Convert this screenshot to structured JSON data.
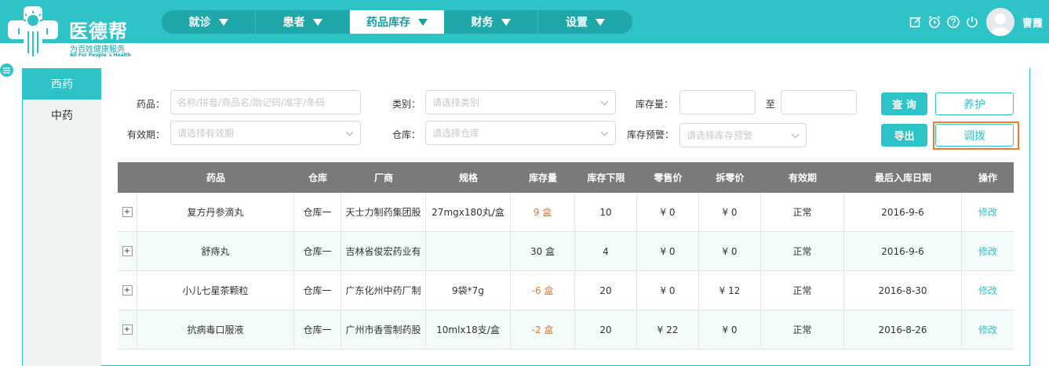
{
  "brand": {
    "name": "医德帮",
    "slogan": "为百姓健康服务",
    "slogan_en": "All For People`s Health",
    "color": "#2ec4c7"
  },
  "nav": {
    "items": [
      {
        "label": "就诊"
      },
      {
        "label": "患者"
      },
      {
        "label": "药品库存",
        "active": true
      },
      {
        "label": "财务"
      },
      {
        "label": "设置"
      }
    ]
  },
  "user": {
    "name": "曹霞"
  },
  "top_icons": [
    "edit-icon",
    "alarm-icon",
    "help-icon",
    "power-icon"
  ],
  "side": {
    "items": [
      {
        "label": "西药",
        "active": true
      },
      {
        "label": "中药"
      }
    ]
  },
  "filters": {
    "drug_label": "药品：",
    "drug_placeholder": "名称/拼音/商品名/助记码/准字/条码",
    "category_label": "类别：",
    "category_placeholder": "请选择类别",
    "stock_label": "库存量：",
    "stock_to": "至",
    "expiry_label": "有效期：",
    "expiry_placeholder": "请选择有效期",
    "warehouse_label": "仓库：",
    "warehouse_placeholder": "请选择仓库",
    "alert_label": "库存预警：",
    "alert_placeholder": "请选择库存预警"
  },
  "buttons": {
    "query": "查 询",
    "maintain": "养护",
    "export": "导出",
    "transfer": "调拨"
  },
  "table": {
    "headers": [
      "药品",
      "仓库",
      "厂商",
      "规格",
      "库存量",
      "库存下限",
      "零售价",
      "拆零价",
      "有效期",
      "最后入库日期",
      "操作"
    ],
    "rows": [
      {
        "drug": "复方丹参滴丸",
        "warehouse": "仓库一",
        "maker": "天士力制药集团股",
        "spec": "27mgx180丸/盒",
        "stock": "9 盒",
        "stock_warn": true,
        "lower": "10",
        "retail": "¥ 0",
        "split": "¥ 0",
        "expiry": "正常",
        "last_in": "2016-9-6",
        "action": "修改"
      },
      {
        "drug": "舒痔丸",
        "warehouse": "仓库一",
        "maker": "吉林省俊宏药业有",
        "spec": "",
        "stock": "30 盒",
        "stock_warn": false,
        "lower": "4",
        "retail": "¥ 0",
        "split": "¥ 0",
        "expiry": "正常",
        "last_in": "2016-9-6",
        "action": "修改"
      },
      {
        "drug": "小儿七星茶颗粒",
        "warehouse": "仓库一",
        "maker": "广东化州中药厂制",
        "spec": "9袋*7g",
        "stock": "-6 盒",
        "stock_warn": true,
        "lower": "20",
        "retail": "¥ 0",
        "split": "¥ 12",
        "expiry": "正常",
        "last_in": "2016-8-30",
        "action": "修改"
      },
      {
        "drug": "抗病毒口服液",
        "warehouse": "仓库一",
        "maker": "广州市香雪制药股",
        "spec": "10mlx18支/盒",
        "stock": "-2 盒",
        "stock_warn": true,
        "lower": "20",
        "retail": "¥ 22",
        "split": "¥ 0",
        "expiry": "正常",
        "last_in": "2016-8-26",
        "action": "修改"
      }
    ]
  }
}
